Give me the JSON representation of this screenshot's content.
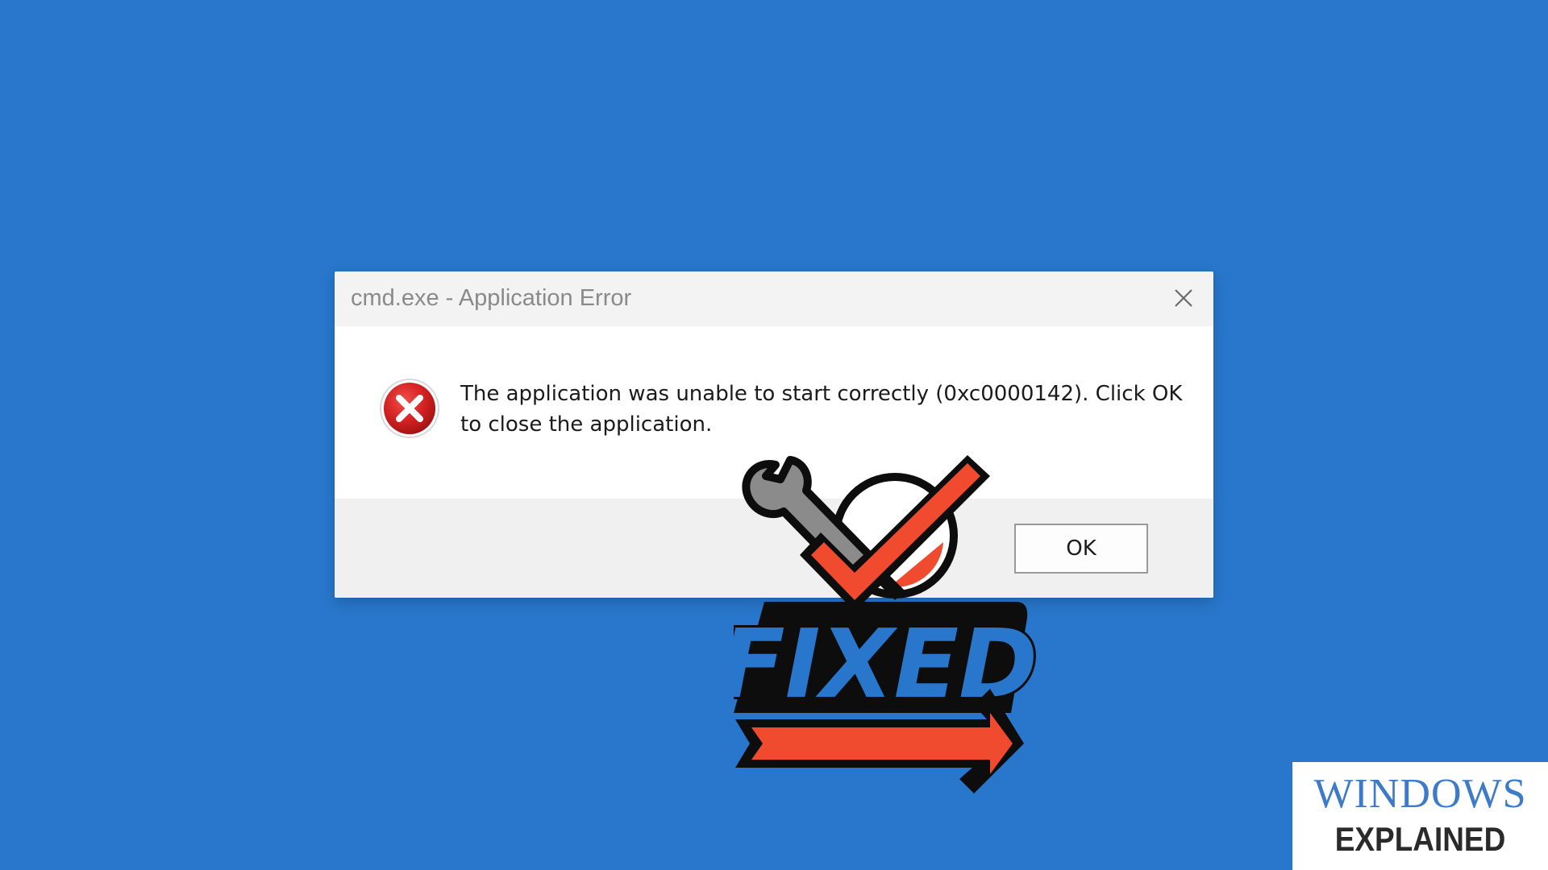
{
  "dialog": {
    "title": "cmd.exe - Application Error",
    "close_icon": "close-icon",
    "error_icon": "error-icon",
    "message_line1": "The application was unable to start correctly (0xc0000142). Click OK",
    "message_line2": "to close the application.",
    "ok_label": "OK"
  },
  "overlay": {
    "fixed_text": "FIXED",
    "icons": [
      "wrench-icon",
      "checkmark-icon",
      "arrow-icon"
    ],
    "colors": {
      "blue": "#2877cc",
      "red": "#f04a2f",
      "outline": "#0d0d0d",
      "wrench": "#8b8b8b"
    }
  },
  "brand": {
    "top": "WINDOWS",
    "bottom": "EXPLAINED"
  },
  "colors": {
    "background": "#2877cc",
    "dialog_titlebar": "#f3f3f3",
    "dialog_footer": "#f0f0f0",
    "error_red": "#d32222"
  }
}
